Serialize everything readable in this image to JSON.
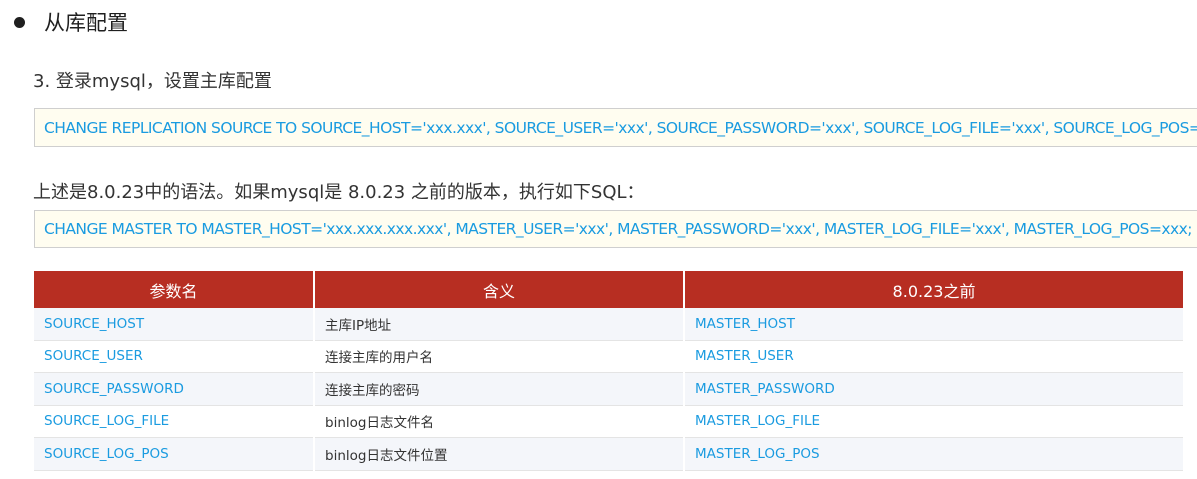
{
  "heading": {
    "bullet_icon": "bullet-dot",
    "title": "从库配置"
  },
  "step": {
    "text": "3. 登录mysql，设置主库配置"
  },
  "code1": {
    "text": "CHANGE REPLICATION SOURCE TO SOURCE_HOST='xxx.xxx', SOURCE_USER='xxx', SOURCE_PASSWORD='xxx', SOURCE_LOG_FILE='xxx', SOURCE_LOG_POS=xxx;"
  },
  "note": {
    "text": "上述是8.0.23中的语法。如果mysql是 8.0.23 之前的版本，执行如下SQL："
  },
  "code2": {
    "text": "CHANGE MASTER TO MASTER_HOST='xxx.xxx.xxx.xxx', MASTER_USER='xxx', MASTER_PASSWORD='xxx', MASTER_LOG_FILE='xxx', MASTER_LOG_POS=xxx;"
  },
  "table": {
    "headers": [
      "参数名",
      "含义",
      "8.0.23之前"
    ],
    "rows": [
      {
        "name": "SOURCE_HOST",
        "desc": "主库IP地址",
        "old": "MASTER_HOST"
      },
      {
        "name": "SOURCE_USER",
        "desc": "连接主库的用户名",
        "old": "MASTER_USER"
      },
      {
        "name": "SOURCE_PASSWORD",
        "desc": "连接主库的密码",
        "old": "MASTER_PASSWORD"
      },
      {
        "name": "SOURCE_LOG_FILE",
        "desc": "binlog日志文件名",
        "old": "MASTER_LOG_FILE"
      },
      {
        "name": "SOURCE_LOG_POS",
        "desc": "binlog日志文件位置",
        "old": "MASTER_LOG_POS"
      }
    ]
  },
  "colors": {
    "header_bg": "#b72e22",
    "code_text": "#1a9be0",
    "code_bg": "#fffdf0"
  }
}
